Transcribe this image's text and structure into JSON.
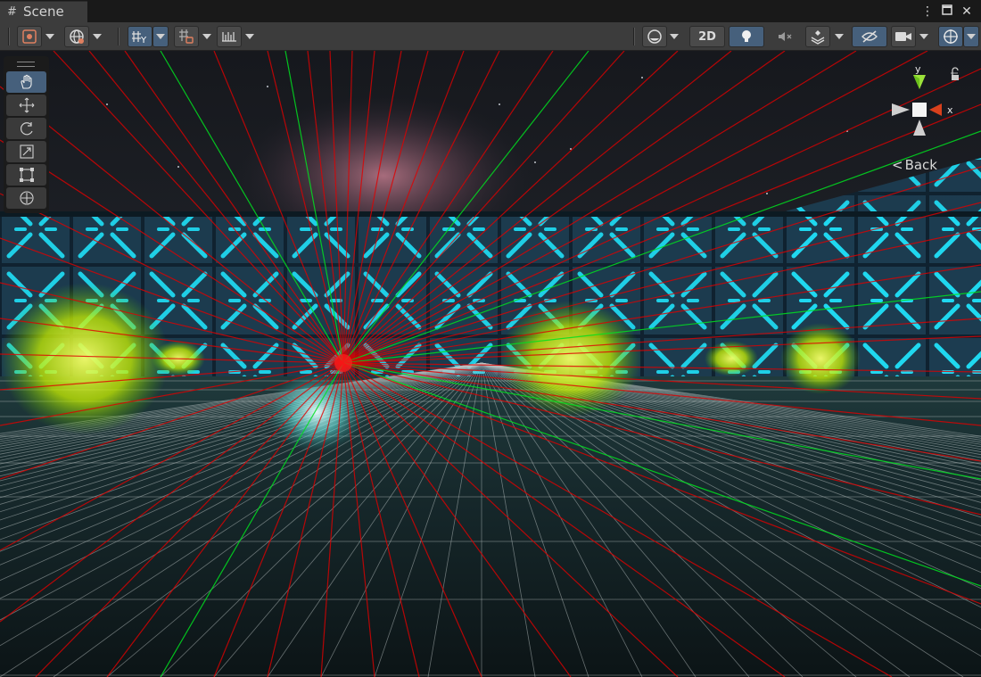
{
  "tab": {
    "title": "Scene"
  },
  "toolbar": {
    "btn_2d": "2D"
  },
  "gizmo": {
    "axis_y": "y",
    "axis_x": "x",
    "view_label": "Back"
  },
  "colors": {
    "toolbar_bg": "#3c3c3c",
    "active_blue": "#46607c",
    "ray_red": "#e00000",
    "ray_green": "#00e020",
    "neon_cyan": "#19d6ee",
    "orb_yellow": "#e6f000"
  },
  "icons": {
    "tab": "grid-hash-icon",
    "tools": [
      "hand-icon",
      "move-icon",
      "rotate-icon",
      "scale-icon",
      "rect-transform-icon",
      "transform-icon"
    ]
  }
}
